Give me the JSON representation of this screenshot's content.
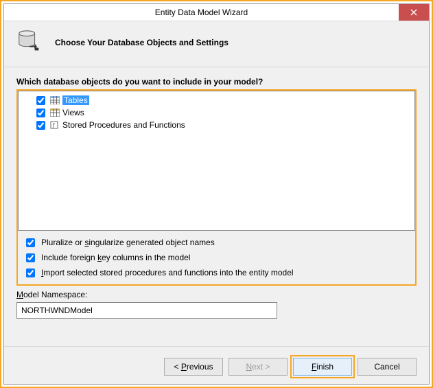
{
  "window": {
    "title": "Entity Data Model Wizard"
  },
  "header": {
    "text": "Choose Your Database Objects and Settings"
  },
  "question": "Which database objects do you want to include in your model?",
  "tree": {
    "items": [
      {
        "label": "Tables",
        "checked": true,
        "selected": true
      },
      {
        "label": "Views",
        "checked": true,
        "selected": false
      },
      {
        "label": "Stored Procedures and Functions",
        "checked": true,
        "selected": false
      }
    ]
  },
  "options": {
    "pluralize": {
      "label_pre": "Pluralize or ",
      "u": "s",
      "label_post": "ingularize generated object names",
      "checked": true
    },
    "fk": {
      "label_pre": "Include foreign ",
      "u": "k",
      "label_post": "ey columns in the model",
      "checked": true
    },
    "import": {
      "label_pre": "",
      "u": "I",
      "label_post": "mport selected stored procedures and functions into the entity model",
      "checked": true
    }
  },
  "namespace": {
    "label_pre": "",
    "u": "M",
    "label_post": "odel Namespace:",
    "value": "NORTHWNDModel"
  },
  "buttons": {
    "previous": {
      "pre": "< ",
      "u": "P",
      "post": "revious"
    },
    "next": {
      "pre": "",
      "u": "N",
      "post": "ext >"
    },
    "finish": {
      "pre": "",
      "u": "F",
      "post": "inish"
    },
    "cancel": {
      "pre": "Cancel",
      "u": "",
      "post": ""
    }
  }
}
